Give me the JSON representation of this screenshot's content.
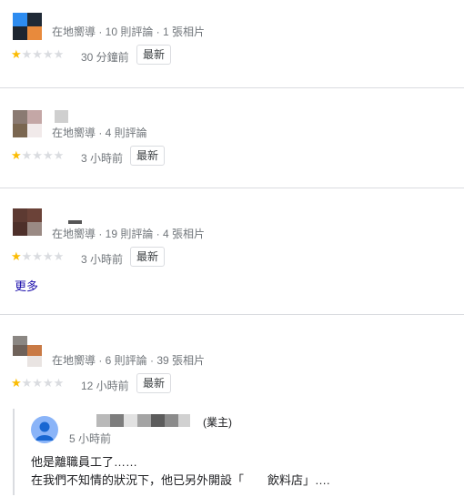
{
  "reviews": [
    {
      "meta": "在地嚮導 · 10 則評論 · 1 張相片",
      "rating": 1,
      "time": "30 分鐘前",
      "badge": "最新"
    },
    {
      "meta": "在地嚮導 · 4 則評論",
      "rating": 1,
      "time": "3 小時前",
      "badge": "最新"
    },
    {
      "meta": "在地嚮導 · 19 則評論 · 4 張相片",
      "rating": 1,
      "time": "3 小時前",
      "badge": "最新",
      "more": "更多"
    },
    {
      "meta": "在地嚮導 · 6 則評論 · 39 張相片",
      "rating": 1,
      "time": "12 小時前",
      "badge": "最新"
    }
  ],
  "owner_reply": {
    "label": "(業主)",
    "time": "5 小時前",
    "line1": "他是離職員工了……",
    "line2": "在我們不知情的狀況下，他已另外開設「",
    "line2_tail": "飲料店」…."
  },
  "colors": {
    "star": "#fbbc04",
    "star_empty": "#dadce0",
    "link": "#1a0dab"
  },
  "icons": {
    "star": "star-icon",
    "owner_avatar": "person-icon"
  }
}
